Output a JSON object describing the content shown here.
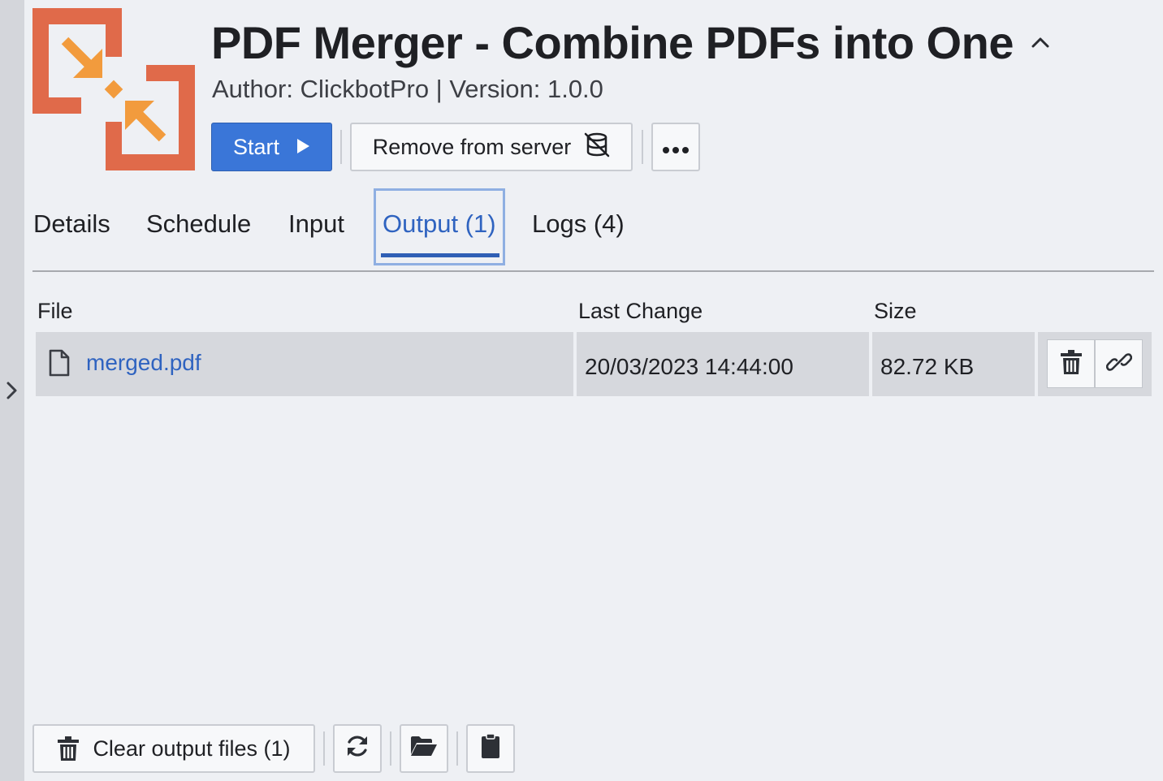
{
  "app": {
    "title": "PDF Merger - Combine PDFs into One",
    "subtitle": "Author: ClickbotPro | Version: 1.0.0",
    "logo_color": "#e06a4a",
    "arrow_color": "#f29b3d"
  },
  "toolbar": {
    "start_label": "Start",
    "remove_label": "Remove from server",
    "more_icon": "ellipsis-icon",
    "primary_color": "#3a76d8"
  },
  "tabs": [
    {
      "label": "Details"
    },
    {
      "label": "Schedule"
    },
    {
      "label": "Input"
    },
    {
      "label": "Output (1)",
      "active": true
    },
    {
      "label": "Logs (4)"
    }
  ],
  "table": {
    "columns": [
      "File",
      "Last Change",
      "Size"
    ],
    "rows": [
      {
        "file": "merged.pdf",
        "last_change": "20/03/2023 14:44:00",
        "size": "82.72 KB"
      }
    ]
  },
  "footer": {
    "clear_label": "Clear output files (1)",
    "icons": [
      "refresh-icon",
      "folder-open-icon",
      "clipboard-icon"
    ]
  }
}
